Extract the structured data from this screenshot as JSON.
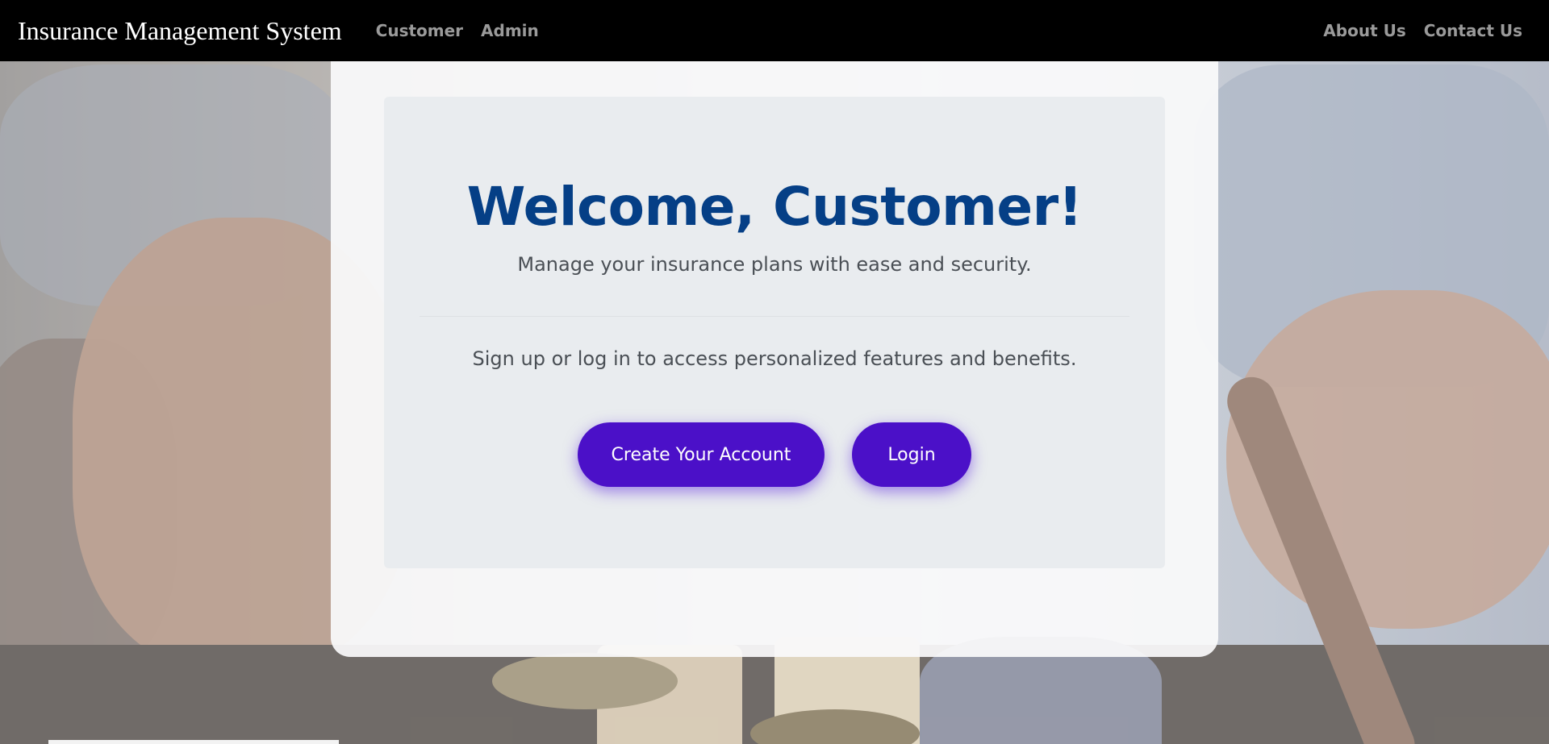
{
  "navbar": {
    "brand": "Insurance Management System",
    "left_links": [
      "Customer",
      "Admin"
    ],
    "right_links": [
      "About Us",
      "Contact Us"
    ]
  },
  "hero": {
    "title": "Welcome, Customer!",
    "subtitle": "Manage your insurance plans with ease and security.",
    "lead": "Sign up or log in to access personalized features and benefits.",
    "create_account_label": "Create Your Account",
    "login_label": "Login"
  },
  "colors": {
    "navbar_bg": "#000000",
    "title": "#053f86",
    "button_bg": "#4b10c8",
    "jumbotron_bg": "#e9ecef"
  },
  "background": {
    "icon": "justice-scales-photo"
  }
}
